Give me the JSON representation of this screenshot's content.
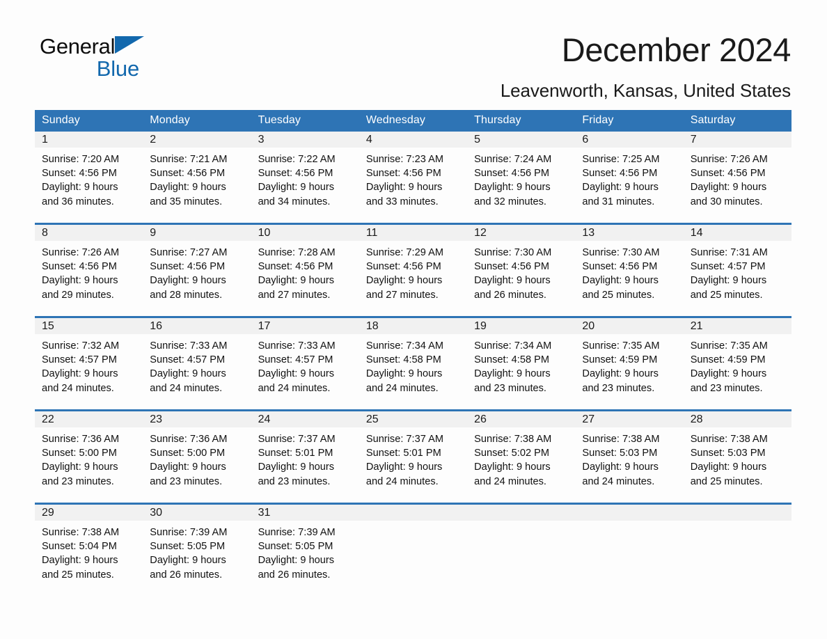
{
  "brand": {
    "name_part1": "General",
    "name_part2": "Blue",
    "triangle_color": "#1268ad",
    "accent_color": "#2e74b5"
  },
  "header": {
    "month_title": "December 2024",
    "location": "Leavenworth, Kansas, United States"
  },
  "calendar": {
    "weekday_headers": [
      "Sunday",
      "Monday",
      "Tuesday",
      "Wednesday",
      "Thursday",
      "Friday",
      "Saturday"
    ],
    "weeks": [
      [
        {
          "day": "1",
          "info": "Sunrise: 7:20 AM\nSunset: 4:56 PM\nDaylight: 9 hours\nand 36 minutes."
        },
        {
          "day": "2",
          "info": "Sunrise: 7:21 AM\nSunset: 4:56 PM\nDaylight: 9 hours\nand 35 minutes."
        },
        {
          "day": "3",
          "info": "Sunrise: 7:22 AM\nSunset: 4:56 PM\nDaylight: 9 hours\nand 34 minutes."
        },
        {
          "day": "4",
          "info": "Sunrise: 7:23 AM\nSunset: 4:56 PM\nDaylight: 9 hours\nand 33 minutes."
        },
        {
          "day": "5",
          "info": "Sunrise: 7:24 AM\nSunset: 4:56 PM\nDaylight: 9 hours\nand 32 minutes."
        },
        {
          "day": "6",
          "info": "Sunrise: 7:25 AM\nSunset: 4:56 PM\nDaylight: 9 hours\nand 31 minutes."
        },
        {
          "day": "7",
          "info": "Sunrise: 7:26 AM\nSunset: 4:56 PM\nDaylight: 9 hours\nand 30 minutes."
        }
      ],
      [
        {
          "day": "8",
          "info": "Sunrise: 7:26 AM\nSunset: 4:56 PM\nDaylight: 9 hours\nand 29 minutes."
        },
        {
          "day": "9",
          "info": "Sunrise: 7:27 AM\nSunset: 4:56 PM\nDaylight: 9 hours\nand 28 minutes."
        },
        {
          "day": "10",
          "info": "Sunrise: 7:28 AM\nSunset: 4:56 PM\nDaylight: 9 hours\nand 27 minutes."
        },
        {
          "day": "11",
          "info": "Sunrise: 7:29 AM\nSunset: 4:56 PM\nDaylight: 9 hours\nand 27 minutes."
        },
        {
          "day": "12",
          "info": "Sunrise: 7:30 AM\nSunset: 4:56 PM\nDaylight: 9 hours\nand 26 minutes."
        },
        {
          "day": "13",
          "info": "Sunrise: 7:30 AM\nSunset: 4:56 PM\nDaylight: 9 hours\nand 25 minutes."
        },
        {
          "day": "14",
          "info": "Sunrise: 7:31 AM\nSunset: 4:57 PM\nDaylight: 9 hours\nand 25 minutes."
        }
      ],
      [
        {
          "day": "15",
          "info": "Sunrise: 7:32 AM\nSunset: 4:57 PM\nDaylight: 9 hours\nand 24 minutes."
        },
        {
          "day": "16",
          "info": "Sunrise: 7:33 AM\nSunset: 4:57 PM\nDaylight: 9 hours\nand 24 minutes."
        },
        {
          "day": "17",
          "info": "Sunrise: 7:33 AM\nSunset: 4:57 PM\nDaylight: 9 hours\nand 24 minutes."
        },
        {
          "day": "18",
          "info": "Sunrise: 7:34 AM\nSunset: 4:58 PM\nDaylight: 9 hours\nand 24 minutes."
        },
        {
          "day": "19",
          "info": "Sunrise: 7:34 AM\nSunset: 4:58 PM\nDaylight: 9 hours\nand 23 minutes."
        },
        {
          "day": "20",
          "info": "Sunrise: 7:35 AM\nSunset: 4:59 PM\nDaylight: 9 hours\nand 23 minutes."
        },
        {
          "day": "21",
          "info": "Sunrise: 7:35 AM\nSunset: 4:59 PM\nDaylight: 9 hours\nand 23 minutes."
        }
      ],
      [
        {
          "day": "22",
          "info": "Sunrise: 7:36 AM\nSunset: 5:00 PM\nDaylight: 9 hours\nand 23 minutes."
        },
        {
          "day": "23",
          "info": "Sunrise: 7:36 AM\nSunset: 5:00 PM\nDaylight: 9 hours\nand 23 minutes."
        },
        {
          "day": "24",
          "info": "Sunrise: 7:37 AM\nSunset: 5:01 PM\nDaylight: 9 hours\nand 23 minutes."
        },
        {
          "day": "25",
          "info": "Sunrise: 7:37 AM\nSunset: 5:01 PM\nDaylight: 9 hours\nand 24 minutes."
        },
        {
          "day": "26",
          "info": "Sunrise: 7:38 AM\nSunset: 5:02 PM\nDaylight: 9 hours\nand 24 minutes."
        },
        {
          "day": "27",
          "info": "Sunrise: 7:38 AM\nSunset: 5:03 PM\nDaylight: 9 hours\nand 24 minutes."
        },
        {
          "day": "28",
          "info": "Sunrise: 7:38 AM\nSunset: 5:03 PM\nDaylight: 9 hours\nand 25 minutes."
        }
      ],
      [
        {
          "day": "29",
          "info": "Sunrise: 7:38 AM\nSunset: 5:04 PM\nDaylight: 9 hours\nand 25 minutes."
        },
        {
          "day": "30",
          "info": "Sunrise: 7:39 AM\nSunset: 5:05 PM\nDaylight: 9 hours\nand 26 minutes."
        },
        {
          "day": "31",
          "info": "Sunrise: 7:39 AM\nSunset: 5:05 PM\nDaylight: 9 hours\nand 26 minutes."
        },
        {
          "day": "",
          "info": ""
        },
        {
          "day": "",
          "info": ""
        },
        {
          "day": "",
          "info": ""
        },
        {
          "day": "",
          "info": ""
        }
      ]
    ]
  }
}
